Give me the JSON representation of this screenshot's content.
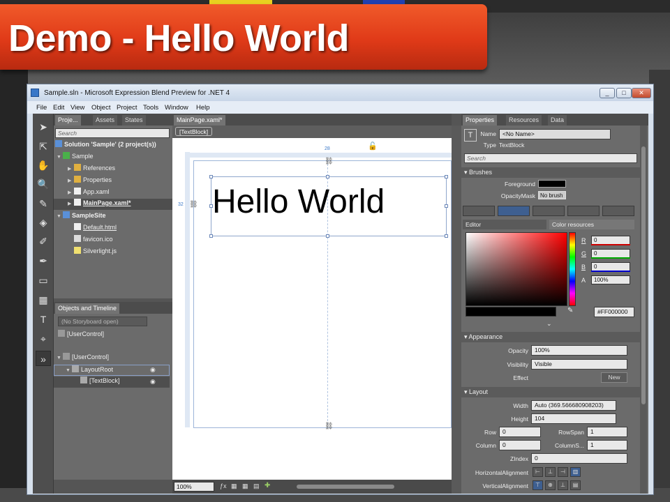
{
  "slide": {
    "title": "Demo - Hello World"
  },
  "window": {
    "title": "Sample.sln - Microsoft Expression Blend Preview for .NET 4",
    "min": "_",
    "max": "□",
    "close": "✕"
  },
  "menu": [
    "File",
    "Edit",
    "View",
    "Object",
    "Project",
    "Tools",
    "Window",
    "Help"
  ],
  "project_panel": {
    "tabs": [
      "Proje...",
      "Assets",
      "States"
    ],
    "search_placeholder": "Search",
    "tree": [
      {
        "label": "Solution 'Sample' (2 project(s))",
        "level": 0
      },
      {
        "label": "Sample",
        "level": 1
      },
      {
        "label": "References",
        "level": 2
      },
      {
        "label": "Properties",
        "level": 2
      },
      {
        "label": "App.xaml",
        "level": 2
      },
      {
        "label": "MainPage.xaml*",
        "level": 2
      },
      {
        "label": "SampleSite",
        "level": 1
      },
      {
        "label": "Default.html",
        "level": 2
      },
      {
        "label": "favicon.ico",
        "level": 2
      },
      {
        "label": "Silverlight.js",
        "level": 2
      }
    ]
  },
  "objects_panel": {
    "title": "Objects and Timeline",
    "storyboard": "(No Storyboard open)",
    "items": [
      "[UserControl]",
      "[UserControl]",
      "LayoutRoot",
      "[TextBlock]"
    ]
  },
  "document": {
    "tab": "MainPage.xaml*",
    "breadcrumb": "[TextBlock]",
    "text": "Hello World",
    "guide_top": "28",
    "guide_left": "32",
    "zoom": "100%"
  },
  "properties": {
    "tabs": [
      "Properties",
      "Resources",
      "Data"
    ],
    "name_label": "Name",
    "name_value": "<No Name>",
    "type_label": "Type",
    "type_value": "TextBlock",
    "search_placeholder": "Search",
    "brushes": "Brushes",
    "foreground": "Foreground",
    "opacitymask": "OpacityMask",
    "no_brush": "No brush",
    "editor": "Editor",
    "color_resources": "Color resources",
    "r": "0",
    "g": "0",
    "b": "0",
    "a": "100%",
    "hex": "#FF000000",
    "appearance": "Appearance",
    "opacity_label": "Opacity",
    "opacity": "100%",
    "visibility_label": "Visibility",
    "visibility": "Visible",
    "effect_label": "Effect",
    "effect_btn": "New",
    "layout": "Layout",
    "width_label": "Width",
    "width": "Auto (369.566680908203)",
    "height_label": "Height",
    "height": "104",
    "row_label": "Row",
    "row": "0",
    "rowspan_label": "RowSpan",
    "rowspan": "1",
    "column_label": "Column",
    "column": "0",
    "columnspan_label": "ColumnS...",
    "columnspan": "1",
    "zindex_label": "ZIndex",
    "zindex": "0",
    "halign_label": "HorizontalAlignment",
    "valign_label": "VerticalAlignment"
  },
  "colors": {
    "accent": "#3e5f90",
    "banner": "#e03a18"
  }
}
